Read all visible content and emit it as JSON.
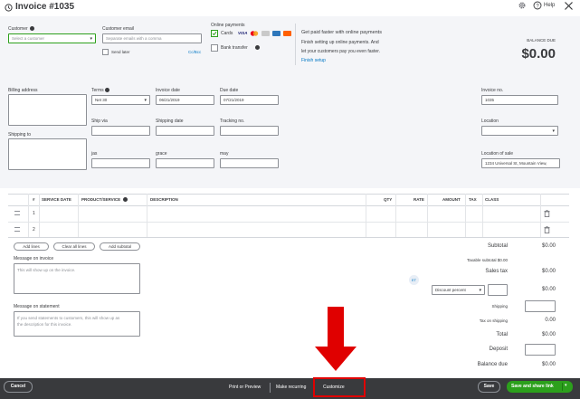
{
  "header": {
    "title": "Invoice #1035",
    "help_label": "Help"
  },
  "customer": {
    "label": "Customer",
    "placeholder": "Select a customer",
    "email_label": "Customer email",
    "email_placeholder": "Separate emails with a comma",
    "cc_bcc": "Cc/Bcc",
    "send_later": "Send later"
  },
  "online_payments": {
    "label": "Online payments",
    "cards_label": "Cards",
    "bank_transfer_label": "Bank transfer",
    "promo_title": "Get paid faster with online payments",
    "promo_text_1": "Finish setting up online payments. And",
    "promo_text_2": "let your customers pay you even faster.",
    "finish_setup": "Finish setup",
    "card_colors": [
      "#1a1f71",
      "#eb001b",
      "#f79e1b",
      "#2e77bb",
      "#ff6000"
    ]
  },
  "balance": {
    "label": "BALANCE DUE",
    "amount": "$0.00"
  },
  "fields": {
    "billing_address": "Billing address",
    "shipping_to": "Shipping to",
    "terms_label": "Terms",
    "terms_value": "Net 30",
    "invoice_date_label": "Invoice date",
    "invoice_date_value": "06/21/2019",
    "due_date_label": "Due date",
    "due_date_value": "07/21/2019",
    "invoice_no_label": "Invoice no.",
    "invoice_no_value": "1035",
    "ship_via": "Ship via",
    "shipping_date": "Shipping date",
    "tracking_no": "Tracking no.",
    "location_label": "Location",
    "custom1": "jas",
    "custom2": "grace",
    "custom3": "may",
    "location_of_sale_label": "Location of sale",
    "location_of_sale_value": "1234 Universal St, Mountain View,"
  },
  "table": {
    "headers": {
      "num": "#",
      "service_date": "SERVICE DATE",
      "product": "PRODUCT/SERVICE",
      "description": "DESCRIPTION",
      "qty": "QTY",
      "rate": "RATE",
      "amount": "AMOUNT",
      "tax": "TAX",
      "class": "CLASS"
    },
    "rows": [
      "1",
      "2"
    ],
    "add_lines": "Add lines",
    "clear_all_lines": "Clear all lines",
    "add_subtotal": "Add subtotal"
  },
  "messages": {
    "invoice_label": "Message on invoice",
    "invoice_placeholder": "This will show up on the invoice.",
    "statement_label": "Message on statement",
    "statement_placeholder_1": "If you send statements to customers, this will show up as",
    "statement_placeholder_2": "the description for this invoice."
  },
  "totals": {
    "subtotal_label": "Subtotal",
    "subtotal_value": "$0.00",
    "taxable_subtotal": "Taxable subtotal $0.00",
    "sales_tax_label": "Sales tax",
    "sales_tax_value": "$0.00",
    "discount_select": "Discount percent",
    "discount_value": "$0.00",
    "shipping_label": "Shipping",
    "tax_on_shipping_label": "Tax on shipping",
    "tax_on_shipping_value": "0.00",
    "total_label": "Total",
    "total_value": "$0.00",
    "deposit_label": "Deposit",
    "balance_due_label": "Balance due",
    "balance_due_value": "$0.00"
  },
  "footer": {
    "cancel": "Cancel",
    "print_preview": "Print or Preview",
    "make_recurring": "Make recurring",
    "customize": "Customize",
    "save": "Save",
    "save_and_share": "Save and share link"
  },
  "colors": {
    "accent_green": "#2ca01c",
    "link_blue": "#0077c5",
    "footer_bg": "#393a3d",
    "annotation_red": "#e00000"
  }
}
